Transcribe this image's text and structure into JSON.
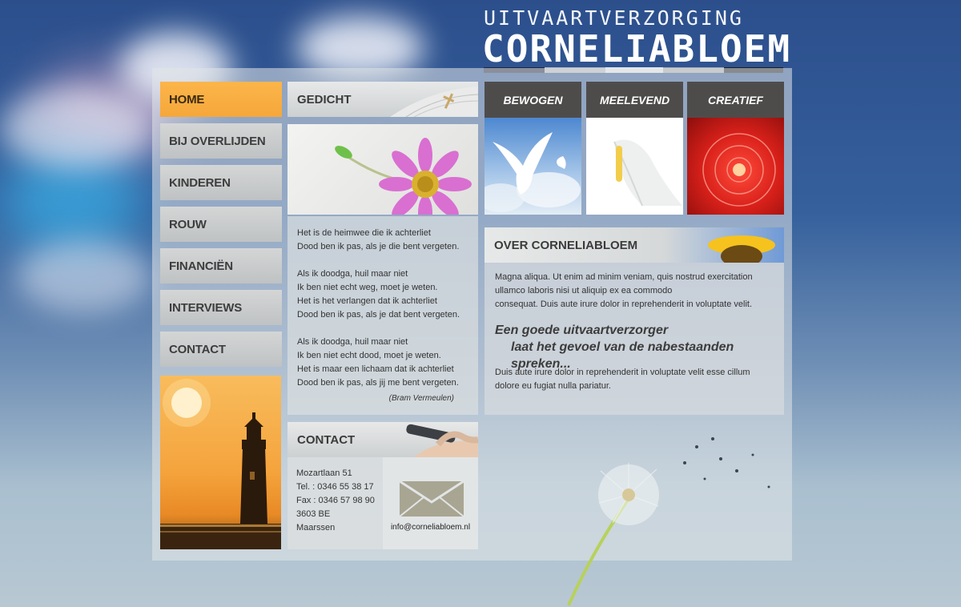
{
  "header": {
    "subtitle": "UITVAARTVERZORGING",
    "title": "CORNELIABLOEM"
  },
  "nav": {
    "items": [
      {
        "label": "HOME",
        "active": true
      },
      {
        "label": "BIJ OVERLIJDEN",
        "active": false
      },
      {
        "label": "KINDEREN",
        "active": false
      },
      {
        "label": "ROUW",
        "active": false
      },
      {
        "label": "FINANCIËN",
        "active": false
      },
      {
        "label": "INTERVIEWS",
        "active": false
      },
      {
        "label": "CONTACT",
        "active": false
      }
    ]
  },
  "poem": {
    "heading": "GEDICHT",
    "stanzas": [
      [
        "Het is de heimwee die ik achterliet",
        "Dood ben ik pas, als je die bent vergeten."
      ],
      [
        "Als ik doodga, huil maar niet",
        "Ik ben niet echt weg, moet je weten.",
        "Het is het verlangen dat ik achterliet",
        "Dood ben ik pas, als je dat bent vergeten."
      ],
      [
        "Als ik doodga, huil maar niet",
        "Ik ben niet echt dood, moet je weten.",
        "Het is maar een lichaam dat ik achterliet",
        "Dood ben ik pas, als jij me bent vergeten."
      ]
    ],
    "author": "(Bram Vermeulen)"
  },
  "contact": {
    "heading": "CONTACT",
    "lines": [
      "Mozartlaan 51",
      "Tel. : 0346 55 38 17",
      "Fax : 0346 57 98 90",
      "3603 BE",
      "Maarssen"
    ],
    "email": "info@corneliabloem.nl"
  },
  "themes": [
    {
      "label": "BEWOGEN"
    },
    {
      "label": "MEELEVEND"
    },
    {
      "label": "CREATIEF"
    }
  ],
  "about": {
    "heading": "OVER CORNELIABLOEM",
    "text1": "Magna aliqua. Ut enim ad minim veniam, quis nostrud exercitation ullamco laboris nisi ut aliquip ex ea commodo",
    "text1b": "consequat. Duis aute irure dolor in reprehenderit in voluptate velit.",
    "quote1": "Een goede uitvaartverzorger",
    "quote2": "laat het gevoel van de nabestaanden spreken...",
    "text2": "Duis aute irure dolor in reprehenderit in voluptate velit esse cillum dolore eu fugiat nulla pariatur."
  },
  "colors": {
    "accent": "#f9b044",
    "tile_header": "#4e4c4b"
  }
}
